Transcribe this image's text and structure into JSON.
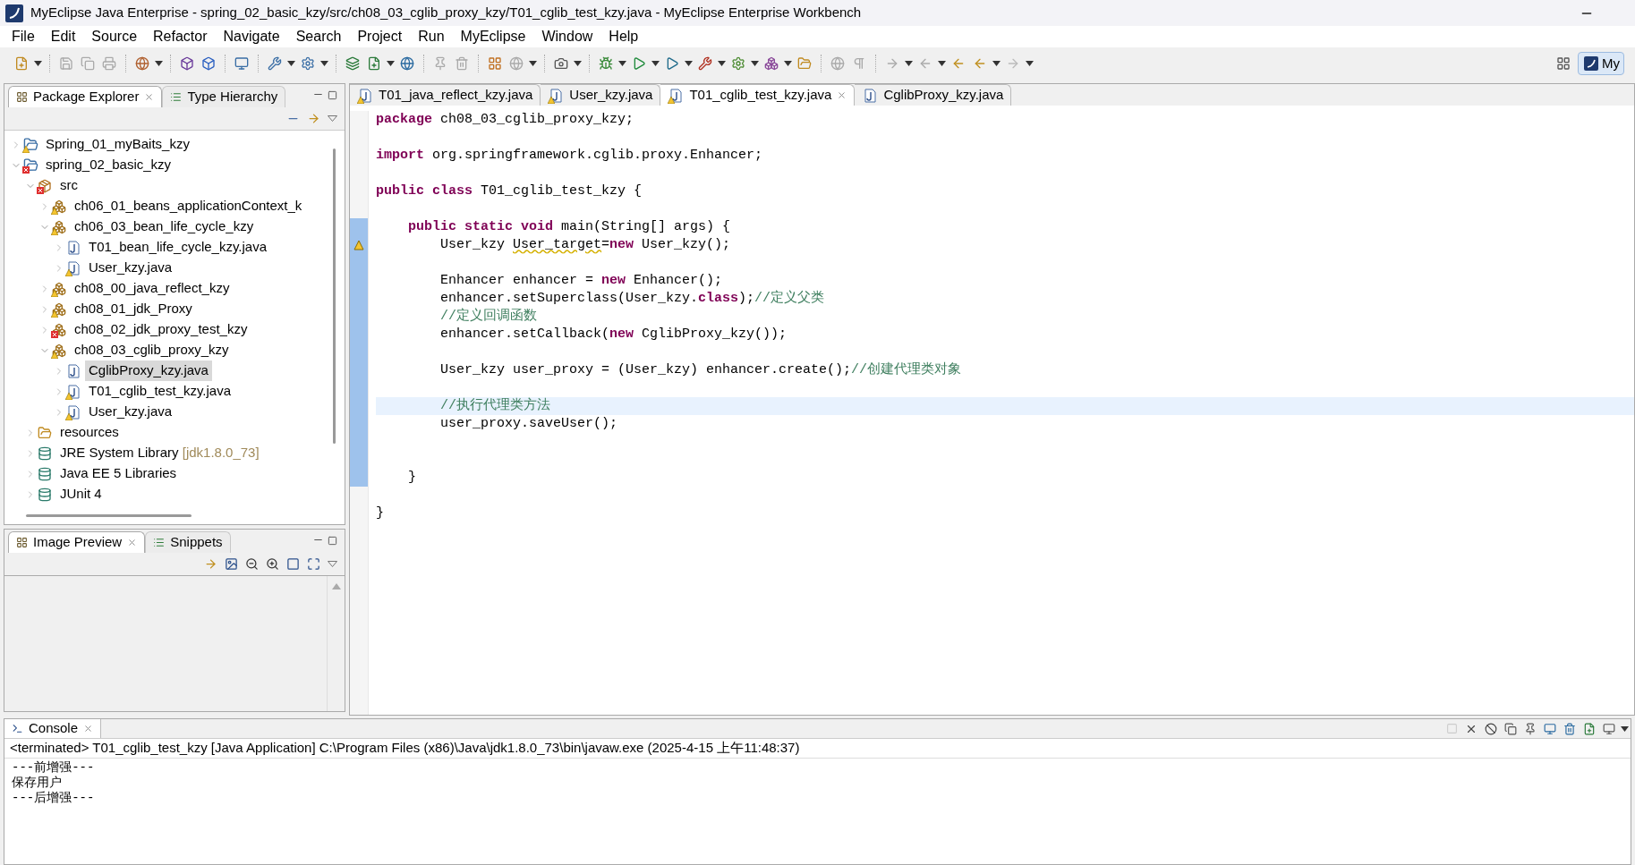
{
  "window": {
    "title": "MyEclipse Java Enterprise - spring_02_basic_kzy/src/ch08_03_cglib_proxy_kzy/T01_cglib_test_kzy.java - MyEclipse Enterprise Workbench"
  },
  "menu": [
    "File",
    "Edit",
    "Source",
    "Refactor",
    "Navigate",
    "Search",
    "Project",
    "Run",
    "MyEclipse",
    "Window",
    "Help"
  ],
  "perspective": {
    "label": "My"
  },
  "package_explorer": {
    "tabs": [
      {
        "label": "Package Explorer",
        "selected": true
      },
      {
        "label": "Type Hierarchy",
        "selected": false
      }
    ],
    "tree": [
      {
        "label": "Spring_01_myBaits_kzy",
        "kind": "project",
        "warning": true,
        "expanded": false,
        "selected": false
      },
      {
        "label": "spring_02_basic_kzy",
        "kind": "project",
        "error": true,
        "expanded": true,
        "selected": false,
        "children": [
          {
            "label": "src",
            "kind": "source-folder",
            "error": true,
            "expanded": true,
            "selected": false,
            "children": [
              {
                "label": "ch06_01_beans_applicationContext_k",
                "kind": "package",
                "warning": true,
                "expanded": false,
                "selected": false
              },
              {
                "label": "ch06_03_bean_life_cycle_kzy",
                "kind": "package",
                "warning": true,
                "expanded": true,
                "selected": false,
                "children": [
                  {
                    "label": "T01_bean_life_cycle_kzy.java",
                    "kind": "java-file",
                    "expanded": false,
                    "selected": false
                  },
                  {
                    "label": "User_kzy.java",
                    "kind": "java-file",
                    "warning": true,
                    "expanded": false,
                    "selected": false
                  }
                ]
              },
              {
                "label": "ch08_00_java_reflect_kzy",
                "kind": "package",
                "warning": true,
                "expanded": false,
                "selected": false
              },
              {
                "label": "ch08_01_jdk_Proxy",
                "kind": "package",
                "warning": true,
                "expanded": false,
                "selected": false
              },
              {
                "label": "ch08_02_jdk_proxy_test_kzy",
                "kind": "package",
                "error": true,
                "expanded": false,
                "selected": false
              },
              {
                "label": "ch08_03_cglib_proxy_kzy",
                "kind": "package",
                "warning": true,
                "expanded": true,
                "selected": false,
                "children": [
                  {
                    "label": "CglibProxy_kzy.java",
                    "kind": "java-file",
                    "expanded": false,
                    "selected": true
                  },
                  {
                    "label": "T01_cglib_test_kzy.java",
                    "kind": "java-file",
                    "warning": true,
                    "expanded": false,
                    "selected": false
                  },
                  {
                    "label": "User_kzy.java",
                    "kind": "java-file",
                    "warning": true,
                    "expanded": false,
                    "selected": false
                  }
                ]
              }
            ]
          },
          {
            "label": "resources",
            "kind": "folder",
            "expanded": false,
            "selected": false
          },
          {
            "label": "JRE System Library",
            "suffix": "[jdk1.8.0_73]",
            "kind": "library",
            "expanded": false,
            "selected": false
          },
          {
            "label": "Java EE 5 Libraries",
            "kind": "library",
            "expanded": false,
            "selected": false
          },
          {
            "label": "JUnit 4",
            "kind": "library",
            "expanded": false,
            "selected": false
          }
        ]
      }
    ]
  },
  "image_preview": {
    "tabs": [
      {
        "label": "Image Preview",
        "selected": true
      },
      {
        "label": "Snippets",
        "selected": false
      }
    ]
  },
  "editor": {
    "tabs": [
      {
        "label": "T01_java_reflect_kzy.java",
        "selected": false,
        "warning": true
      },
      {
        "label": "User_kzy.java",
        "selected": false,
        "warning": true
      },
      {
        "label": "T01_cglib_test_kzy.java",
        "selected": true,
        "warning": true
      },
      {
        "label": "CglibProxy_kzy.java",
        "selected": false
      }
    ],
    "lines": [
      {
        "kind": "code",
        "tokens": [
          {
            "kind": "keyword",
            "text": "package"
          },
          {
            "kind": "text",
            "text": " ch08_03_cglib_proxy_kzy;"
          }
        ]
      },
      {
        "kind": "blank"
      },
      {
        "kind": "code",
        "tokens": [
          {
            "kind": "keyword",
            "text": "import"
          },
          {
            "kind": "text",
            "text": " org.springframework.cglib.proxy.Enhancer;"
          }
        ]
      },
      {
        "kind": "blank"
      },
      {
        "kind": "code",
        "tokens": [
          {
            "kind": "keyword",
            "text": "public class"
          },
          {
            "kind": "text",
            "text": " T01_cglib_test_kzy {"
          }
        ]
      },
      {
        "kind": "blank"
      },
      {
        "kind": "code",
        "in_range": true,
        "tokens": [
          {
            "kind": "keyword",
            "text": "    public static void"
          },
          {
            "kind": "text",
            "text": " main(String[] args) {"
          }
        ]
      },
      {
        "kind": "code",
        "in_range": true,
        "marker": true,
        "tokens": [
          {
            "kind": "text",
            "text": "        User_kzy "
          },
          {
            "kind": "warning",
            "text": "User_target"
          },
          {
            "kind": "text",
            "text": "="
          },
          {
            "kind": "keyword",
            "text": "new"
          },
          {
            "kind": "text",
            "text": " User_kzy();"
          }
        ]
      },
      {
        "kind": "blank",
        "in_range": true
      },
      {
        "kind": "code",
        "in_range": true,
        "tokens": [
          {
            "kind": "text",
            "text": "        Enhancer enhancer = "
          },
          {
            "kind": "keyword",
            "text": "new"
          },
          {
            "kind": "text",
            "text": " Enhancer();"
          }
        ]
      },
      {
        "kind": "code",
        "in_range": true,
        "tokens": [
          {
            "kind": "text",
            "text": "        enhancer.setSuperclass(User_kzy."
          },
          {
            "kind": "keyword",
            "text": "class"
          },
          {
            "kind": "text",
            "text": ");"
          },
          {
            "kind": "comment",
            "text": "//定义父类"
          }
        ]
      },
      {
        "kind": "code",
        "in_range": true,
        "tokens": [
          {
            "kind": "comment",
            "text": "        //定义回调函数"
          }
        ]
      },
      {
        "kind": "code",
        "in_range": true,
        "tokens": [
          {
            "kind": "text",
            "text": "        enhancer.setCallback("
          },
          {
            "kind": "keyword",
            "text": "new"
          },
          {
            "kind": "text",
            "text": " CglibProxy_kzy());"
          }
        ]
      },
      {
        "kind": "blank",
        "in_range": true
      },
      {
        "kind": "code",
        "in_range": true,
        "tokens": [
          {
            "kind": "text",
            "text": "        User_kzy user_proxy = (User_kzy) enhancer.create();"
          },
          {
            "kind": "comment",
            "text": "//创建代理类对象"
          }
        ]
      },
      {
        "kind": "blank",
        "in_range": true
      },
      {
        "kind": "code",
        "in_range": true,
        "current": true,
        "tokens": [
          {
            "kind": "comment",
            "text": "        //执行代理类方法"
          }
        ]
      },
      {
        "kind": "code",
        "in_range": true,
        "tokens": [
          {
            "kind": "text",
            "text": "        user_proxy.saveUser();"
          }
        ]
      },
      {
        "kind": "blank",
        "in_range": true
      },
      {
        "kind": "blank",
        "in_range": true
      },
      {
        "kind": "code",
        "in_range": true,
        "tokens": [
          {
            "kind": "text",
            "text": "    }"
          }
        ]
      },
      {
        "kind": "blank"
      },
      {
        "kind": "code",
        "tokens": [
          {
            "kind": "text",
            "text": "}"
          }
        ]
      }
    ]
  },
  "console": {
    "tab": "Console",
    "header": "<terminated> T01_cglib_test_kzy [Java Application] C:\\Program Files (x86)\\Java\\jdk1.8.0_73\\bin\\javaw.exe (2025-4-15 上午11:48:37)",
    "lines": [
      "---前增强---",
      "保存用户",
      "---后增强---"
    ]
  }
}
